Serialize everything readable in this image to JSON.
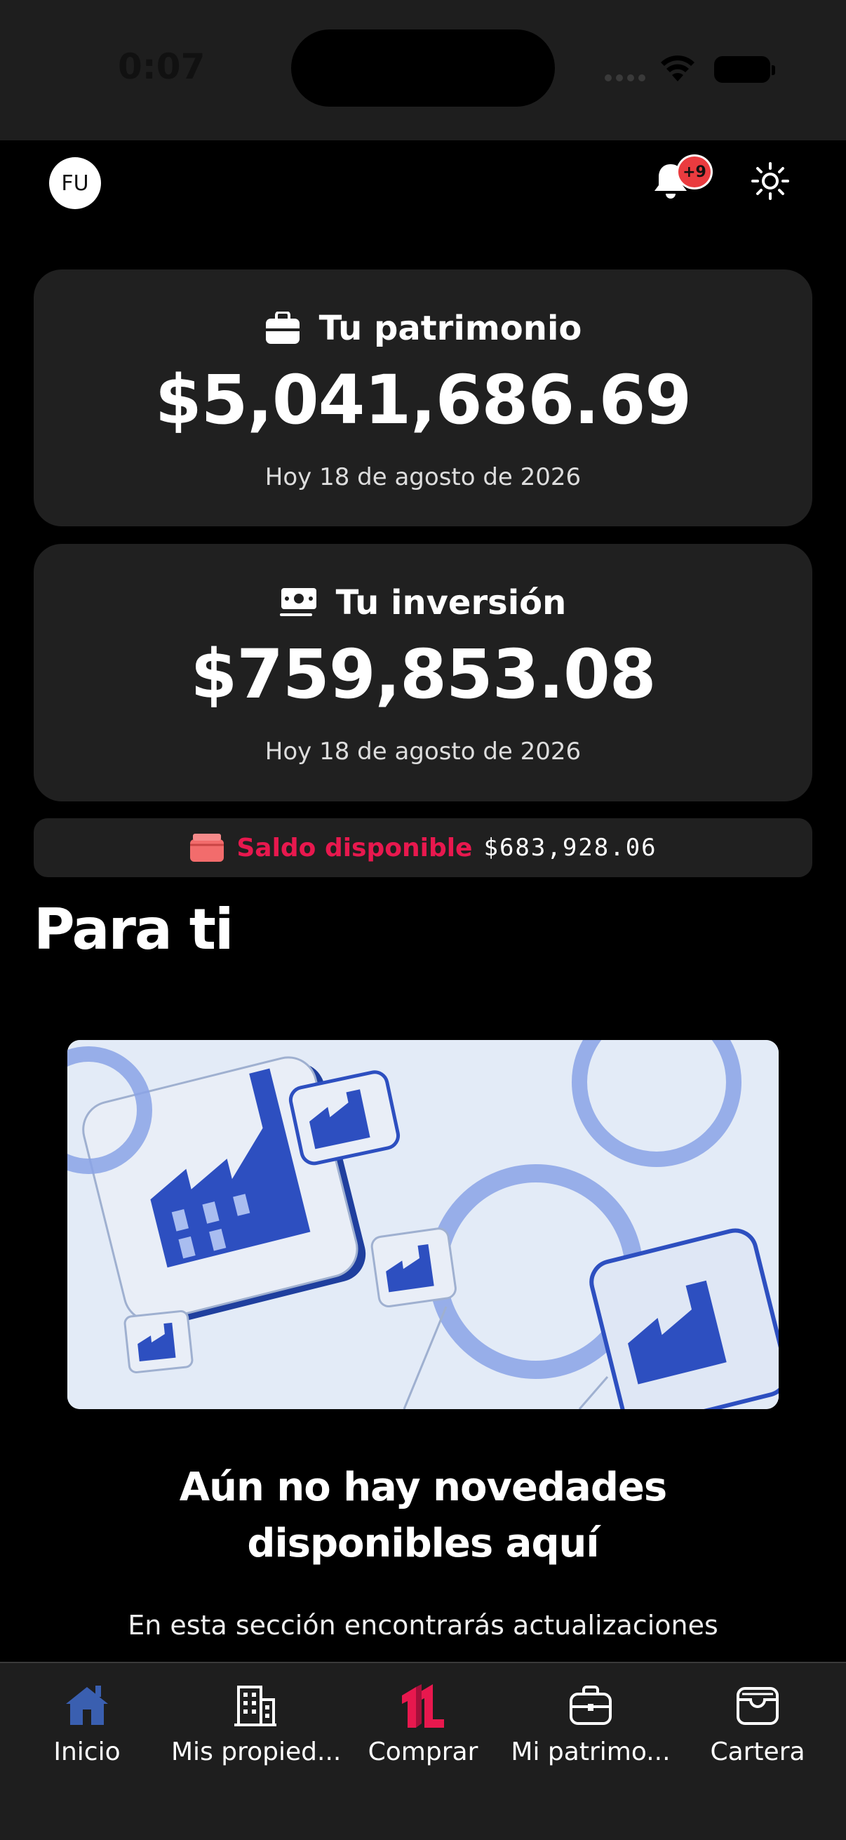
{
  "status_bar": {
    "time": "0:07"
  },
  "header": {
    "avatar_initials": "FU",
    "notification_badge": "+9",
    "icons": [
      "bell-icon",
      "sun-icon"
    ]
  },
  "patrimonio_card": {
    "title": "Tu patrimonio",
    "value": "$5,041,686.69",
    "date": "Hoy 18 de agosto de 2026"
  },
  "inversion_card": {
    "title": "Tu inversión",
    "value": "$759,853.08",
    "date": "Hoy 18 de agosto de 2026"
  },
  "saldo": {
    "label": "Saldo disponible",
    "value": "$683,928.06"
  },
  "section": {
    "title": "Para ti",
    "empty_title": "Aún no hay novedades disponibles aquí",
    "empty_text": "En esta sección encontrarás actualizaciones"
  },
  "bottom_nav": {
    "items": [
      {
        "label": "Inicio",
        "icon": "home-icon"
      },
      {
        "label": "Mis propied...",
        "icon": "building-icon"
      },
      {
        "label": "Comprar",
        "icon": "brand-logo-icon"
      },
      {
        "label": "Mi patrimo...",
        "icon": "briefcase-icon"
      },
      {
        "label": "Cartera",
        "icon": "wallet-icon"
      }
    ]
  },
  "colors": {
    "accent": "#e8184e",
    "badge": "#ea3b3f",
    "card": "#202020",
    "nav_active": "#3a5fb0",
    "illustration_blue": "#2d4fc0"
  }
}
